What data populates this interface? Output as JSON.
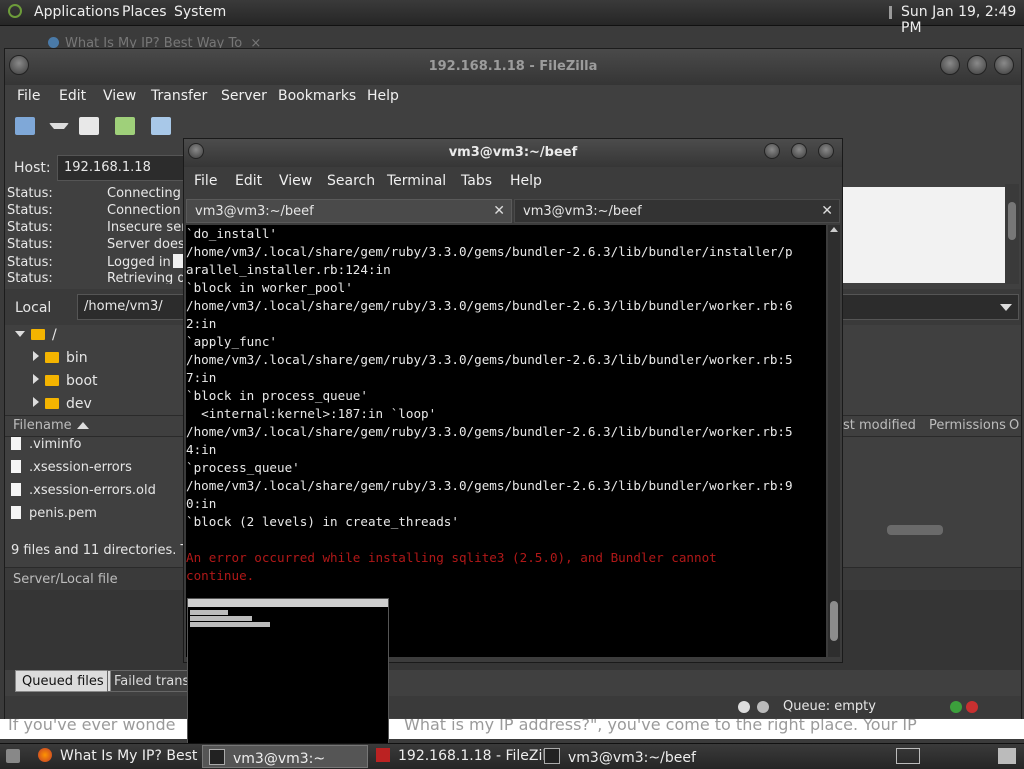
{
  "top_panel": {
    "menus": [
      "Applications",
      "Places",
      "System"
    ],
    "clock": "Sun Jan 19,  2:49 PM"
  },
  "browser_tab": {
    "title": "What Is My IP? Best Way To",
    "close": "×"
  },
  "filezilla": {
    "title": "192.168.1.18 - FileZilla",
    "menu": [
      "File",
      "Edit",
      "View",
      "Transfer",
      "Server",
      "Bookmarks",
      "Help"
    ],
    "host_label": "Host:",
    "host_value": "192.168.1.18",
    "status_log": [
      {
        "key": "Status:",
        "text": "Connecting t"
      },
      {
        "key": "Status:",
        "text": "Connection e"
      },
      {
        "key": "Status:",
        "text": "Insecure serv"
      },
      {
        "key": "Status:",
        "text": "Server does n"
      },
      {
        "key": "Status:",
        "text": "Logged in"
      },
      {
        "key": "Status:",
        "text": "Retrieving di"
      }
    ],
    "local_label": "Local",
    "local_path": "/home/vm3/",
    "tree": [
      {
        "name": "/",
        "expanded": true
      },
      {
        "name": "bin"
      },
      {
        "name": "boot"
      },
      {
        "name": "dev"
      }
    ],
    "file_header": {
      "filename": "Filename",
      "modified": "st modified",
      "permissions": "Permissions",
      "owner": "O"
    },
    "files": [
      ".viminfo",
      ".xsession-errors",
      ".xsession-errors.old",
      "penis.pem"
    ],
    "file_summary": "9 files and 11 directories. Tot",
    "queue_header": "Server/Local file",
    "queue_tabs": [
      "Queued files",
      "Failed transf"
    ],
    "queue_status": "Queue: empty",
    "colors": {
      "green_dot": "#3ca03c",
      "red_dot": "#c83030",
      "folder": "#f4b400"
    }
  },
  "terminal": {
    "title": "vm3@vm3:~/beef",
    "menu": [
      "File",
      "Edit",
      "View",
      "Search",
      "Terminal",
      "Tabs",
      "Help"
    ],
    "tabs": [
      "vm3@vm3:~/beef",
      "vm3@vm3:~/beef"
    ],
    "lines": [
      {
        "text": "`do_install'"
      },
      {
        "text": "/home/vm3/.local/share/gem/ruby/3.3.0/gems/bundler-2.6.3/lib/bundler/installer/p"
      },
      {
        "text": "arallel_installer.rb:124:in"
      },
      {
        "text": "`block in worker_pool'"
      },
      {
        "text": "/home/vm3/.local/share/gem/ruby/3.3.0/gems/bundler-2.6.3/lib/bundler/worker.rb:6"
      },
      {
        "text": "2:in"
      },
      {
        "text": "`apply_func'"
      },
      {
        "text": "/home/vm3/.local/share/gem/ruby/3.3.0/gems/bundler-2.6.3/lib/bundler/worker.rb:5"
      },
      {
        "text": "7:in"
      },
      {
        "text": "`block in process_queue'"
      },
      {
        "text": "  <internal:kernel>:187:in `loop'"
      },
      {
        "text": "/home/vm3/.local/share/gem/ruby/3.3.0/gems/bundler-2.6.3/lib/bundler/worker.rb:5"
      },
      {
        "text": "4:in"
      },
      {
        "text": "`process_queue'"
      },
      {
        "text": "/home/vm3/.local/share/gem/ruby/3.3.0/gems/bundler-2.6.3/lib/bundler/worker.rb:9"
      },
      {
        "text": "0:in"
      },
      {
        "text": "`block (2 levels) in create_threads'"
      },
      {
        "text": ""
      },
      {
        "text": "An error occurred while installing sqlite3 (2.5.0), and Bundler cannot",
        "error": true
      },
      {
        "text": "continue.",
        "error": true
      }
    ],
    "colors": {
      "error": "#b01818",
      "background": "#000000"
    }
  },
  "web_fragment": {
    "line1_left": "If you've ever wonde",
    "line1_right": "What is my IP address?\", you've come to the right place. Your IP"
  },
  "taskbar": {
    "items": [
      {
        "label": "What Is My IP? Best ...",
        "icon": "firefox-icon"
      },
      {
        "label": "vm3@vm3:~",
        "icon": "terminal-icon"
      },
      {
        "label": "192.168.1.18 - FileZilla",
        "icon": "filezilla-icon"
      },
      {
        "label": "vm3@vm3:~/beef",
        "icon": "terminal-icon"
      }
    ]
  }
}
